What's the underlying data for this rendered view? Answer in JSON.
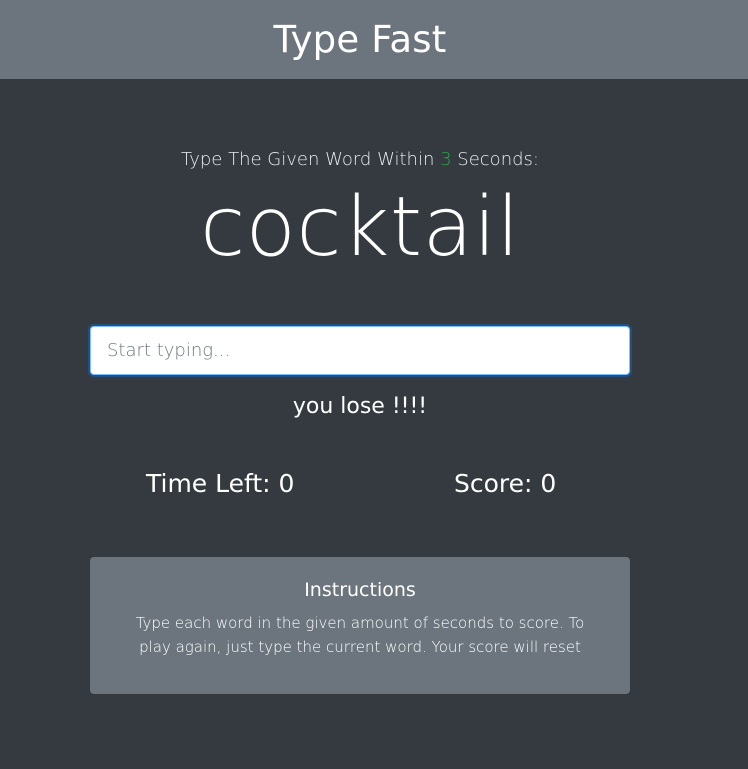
{
  "header": {
    "title": "Type Fast"
  },
  "game": {
    "lead_prefix": "Type The Given Word Within",
    "seconds": "3",
    "lead_suffix": "Seconds:",
    "current_word": "cocktail",
    "input": {
      "placeholder": "Start typing...",
      "value": ""
    },
    "message": "you lose !!!!",
    "time_left_label": "Time Left:",
    "time_left": "0",
    "score_label": "Score:",
    "score": "0"
  },
  "instructions": {
    "title": "Instructions",
    "text": "Type each word in the given amount of seconds to score. To play again, just type the current word. Your score will reset"
  },
  "colors": {
    "header_bg": "#6c757d",
    "page_bg": "#343a40",
    "seconds_accent": "#28a745",
    "card_bg": "#6c757d"
  }
}
